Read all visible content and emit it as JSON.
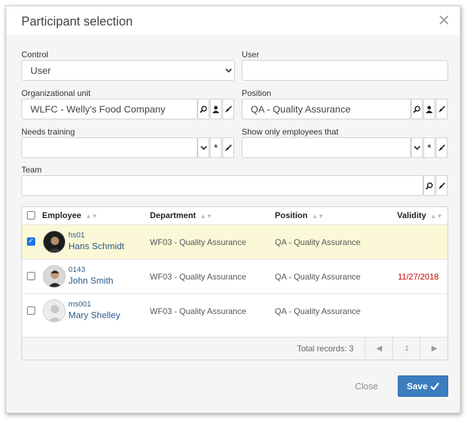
{
  "dialog": {
    "title": "Participant selection",
    "close_glyph": "✕"
  },
  "form": {
    "control": {
      "label": "Control",
      "value": "User",
      "options": [
        "User"
      ]
    },
    "user": {
      "label": "User",
      "value": ""
    },
    "org_unit": {
      "label": "Organizational unit",
      "value": "WLFC - Welly's Food Company"
    },
    "position": {
      "label": "Position",
      "value": "QA - Quality Assurance"
    },
    "needs_training": {
      "label": "Needs training",
      "value": ""
    },
    "show_only": {
      "label": "Show only employees that",
      "value": ""
    },
    "team": {
      "label": "Team",
      "value": ""
    }
  },
  "icons": {
    "search": "search-icon",
    "person": "person-icon",
    "clear": "eraser-icon",
    "dropdown": "chevron-down-icon",
    "asterisk": "asterisk-icon"
  },
  "table": {
    "columns": [
      "Employee",
      "Department",
      "Position",
      "Validity"
    ],
    "rows": [
      {
        "code": "hs01",
        "name": "Hans Schmidt",
        "department": "WF03 - Quality Assurance",
        "position": "QA - Quality Assurance",
        "validity": "",
        "checked": true
      },
      {
        "code": "0143",
        "name": "John Smith",
        "department": "WF03 - Quality Assurance",
        "position": "QA - Quality Assurance",
        "validity": "11/27/2018",
        "checked": false
      },
      {
        "code": "ms001",
        "name": "Mary Shelley",
        "department": "WF03 - Quality Assurance",
        "position": "QA - Quality Assurance",
        "validity": "",
        "checked": false
      }
    ],
    "total_records": "Total records: 3",
    "page": "1",
    "validity_color": "#cc0000"
  },
  "buttons": {
    "close": "Close",
    "save": "Save"
  },
  "colors": {
    "save": "#3b7dbf",
    "link": "#2e5d8a",
    "selected_row": "#fbf8d7"
  }
}
